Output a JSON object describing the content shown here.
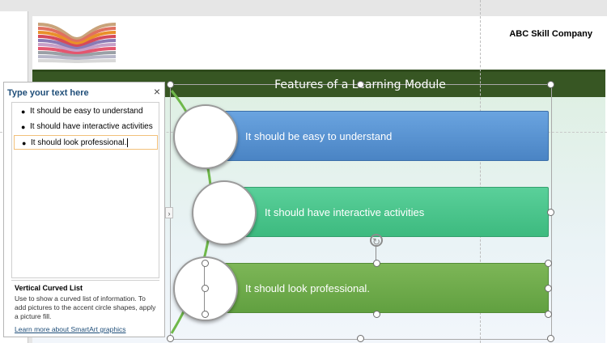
{
  "slide": {
    "company": "ABC Skill Company",
    "title": "Features of a Learning Module",
    "items": [
      "It should be easy to understand",
      "It should have interactive activities",
      "It should look professional."
    ]
  },
  "text_pane": {
    "title": "Type your text here",
    "close_icon": "×",
    "bullets": [
      "It should be easy to understand",
      "It should have interactive activities",
      "It should look professional."
    ],
    "description_title": "Vertical Curved List",
    "description_body": "Use to show a curved list of information. To add pictures to the accent circle shapes, apply a picture fill.",
    "learn_more": "Learn more about SmartArt graphics",
    "toggle_icon": "›"
  },
  "colors": {
    "banner": "#375623",
    "bar_blue": "#5b9bd5",
    "bar_teal": "#4cc48a",
    "bar_green": "#70ad47"
  }
}
